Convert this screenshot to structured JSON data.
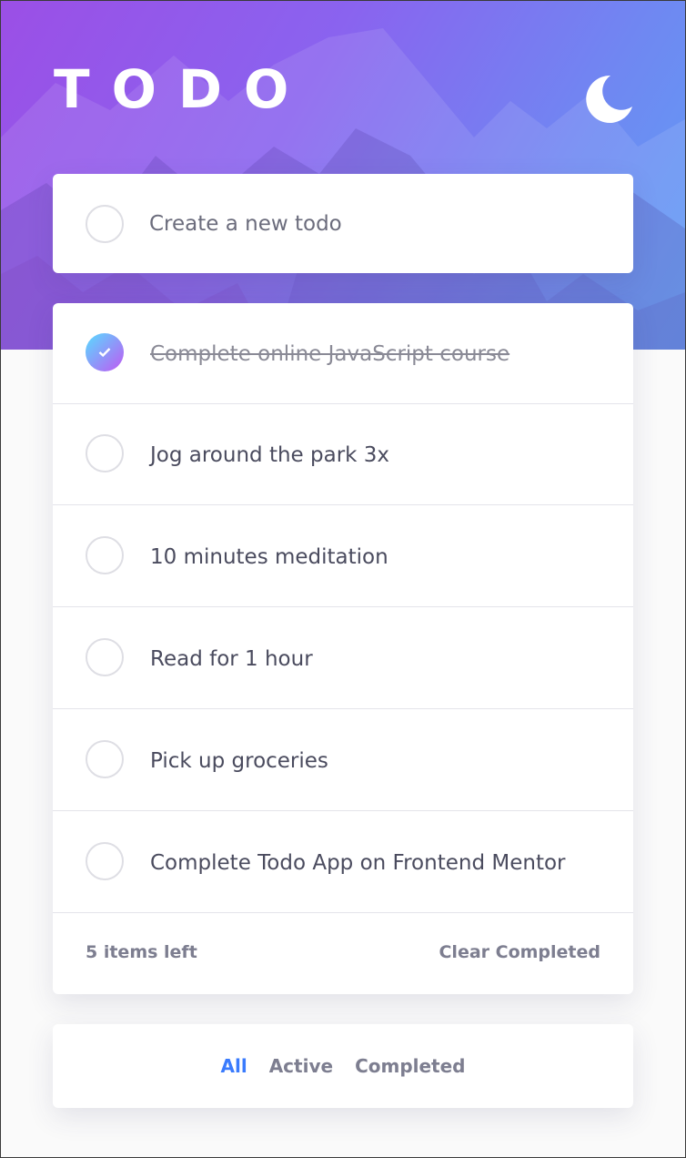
{
  "app": {
    "title": "TODO",
    "theme_icon": "moon-icon"
  },
  "new_todo": {
    "placeholder": "Create a new todo",
    "value": ""
  },
  "todos": [
    {
      "text": "Complete online JavaScript course",
      "completed": true
    },
    {
      "text": "Jog around the park 3x",
      "completed": false
    },
    {
      "text": "10 minutes meditation",
      "completed": false
    },
    {
      "text": "Read for 1 hour",
      "completed": false
    },
    {
      "text": "Pick up groceries",
      "completed": false
    },
    {
      "text": "Complete Todo App on Frontend Mentor",
      "completed": false
    }
  ],
  "footer": {
    "items_left": "5 items left",
    "clear_label": "Clear Completed"
  },
  "filters": [
    {
      "label": "All",
      "active": true
    },
    {
      "label": "Active",
      "active": false
    },
    {
      "label": "Completed",
      "active": false
    }
  ],
  "colors": {
    "accent": "#3a7bfd",
    "check_gradient_start": "#57ddff",
    "check_gradient_end": "#c058f3",
    "hero_start": "#9b4fe6",
    "hero_end": "#5f9ff5"
  }
}
